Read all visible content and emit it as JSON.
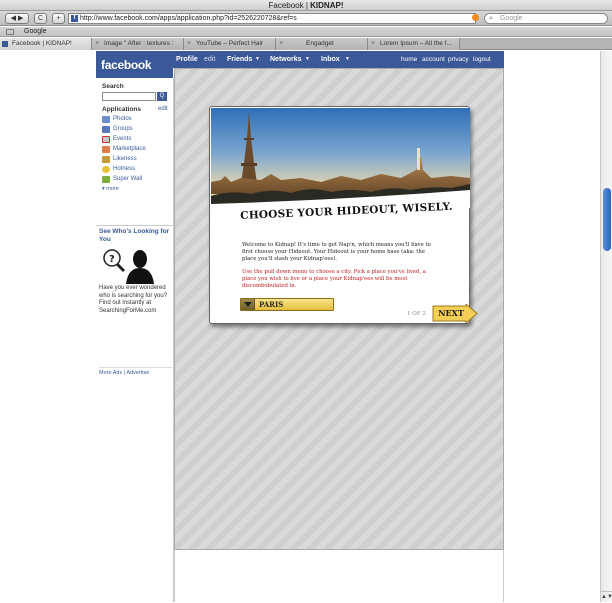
{
  "window": {
    "title_prefix": "Facebook",
    "title_separator": " | ",
    "title_app": "KIDNAP!"
  },
  "toolbar": {
    "url": "http://www.facebook.com/apps/application.php?id=2526220728&ref=s",
    "search_placeholder": "Google",
    "back_glyph": "◀",
    "forward_glyph": "▶",
    "reload_glyph": "C",
    "add_glyph": "+"
  },
  "bookmarks": {
    "items": [
      "Google"
    ]
  },
  "tabs": [
    {
      "label": "Facebook | KIDNAP!",
      "active": true
    },
    {
      "label": "Image \" After : textures :",
      "active": false
    },
    {
      "label": "YouTube – Perfect Hair",
      "active": false
    },
    {
      "label": "Engadget",
      "active": false
    },
    {
      "label": "Lorem Ipsum – All the f...",
      "active": false
    }
  ],
  "facebook": {
    "logo": "facebook",
    "nav": {
      "profile": "Profile",
      "edit": "edit",
      "friends": "Friends",
      "networks": "Networks",
      "inbox": "Inbox"
    },
    "nav_right": {
      "home": "home",
      "account": "account",
      "privacy": "privacy",
      "logout": "logout"
    },
    "sidebar": {
      "search_label": "Search",
      "search_button": "Q",
      "applications_label": "Applications",
      "applications_edit": "edit",
      "apps": [
        {
          "label": "Photos",
          "color": "#6a8fc9"
        },
        {
          "label": "Groups",
          "color": "#5577bb"
        },
        {
          "label": "Events",
          "color": "#c7c7c7"
        },
        {
          "label": "Marketplace",
          "color": "#e07a4a"
        },
        {
          "label": "Likeness",
          "color": "#c49a3a"
        },
        {
          "label": "Hotness",
          "color": "#e8c43a"
        },
        {
          "label": "Super Wall",
          "color": "#7fae3f"
        }
      ],
      "more": "more",
      "ad": {
        "title": "See Who's Looking for You",
        "body": "Have you ever wondered who is searching for you? Find out instantly at SearchingForMe.com",
        "footer": "More Ads | Advertise"
      }
    }
  },
  "app": {
    "headline": "CHOOSE YOUR HIDEOUT, WISELY.",
    "intro": "Welcome to Kidnap! It's time to get Nap'n, which means you'll have to first choose your Hideout. Your Hideout is your home base (aka: the place you'll stash your Kidnap'ees).",
    "instructions": "Use the pull down menu to choose a city. Pick a place you've lived, a place you wish to live or a place your Kidnap'ees will be most discombobulated in.",
    "city_selected": "PARIS",
    "pager": "1 OF 2",
    "next_label": "NEXT"
  },
  "colors": {
    "facebook_blue": "#3b5998",
    "warning_red": "#c0181e",
    "dropdown_gold": "#e6be3e"
  }
}
